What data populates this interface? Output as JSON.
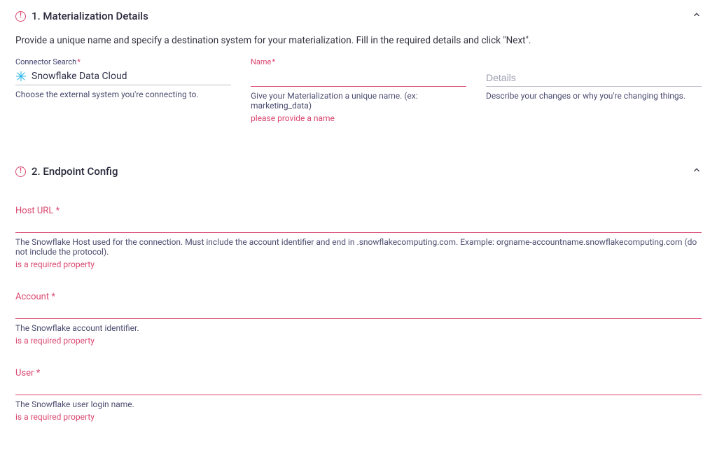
{
  "section1": {
    "title": "1. Materialization Details",
    "intro": "Provide a unique name and specify a destination system for your materialization. Fill in the required details and click \"Next\".",
    "connector": {
      "label": "Connector Search",
      "value": "Snowflake Data Cloud",
      "helper": "Choose the external system you're connecting to."
    },
    "name": {
      "label": "Name",
      "helper": "Give your Materialization a unique name. (ex: marketing_data)",
      "error": "please provide a name",
      "value": ""
    },
    "details": {
      "placeholder": "Details",
      "helper": "Describe your changes or why you're changing things.",
      "value": ""
    }
  },
  "section2": {
    "title": "2. Endpoint Config",
    "fields": [
      {
        "label": "Host URL",
        "helper": "The Snowflake Host used for the connection. Must include the account identifier and end in .snowflakecomputing.com. Example: orgname-accountname.snowflakecomputing.com (do not include the protocol).",
        "error": "is a required property",
        "value": ""
      },
      {
        "label": "Account",
        "helper": "The Snowflake account identifier.",
        "error": "is a required property",
        "value": ""
      },
      {
        "label": "User",
        "helper": "The Snowflake user login name.",
        "error": "is a required property",
        "value": ""
      }
    ]
  },
  "asterisk": "*"
}
